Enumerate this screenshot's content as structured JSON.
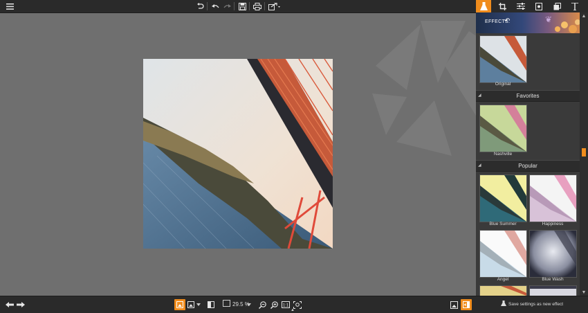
{
  "toolbar": {
    "menu_icon": "hamburger-icon",
    "rotate_label": "↶",
    "undo_label": "↶",
    "redo_label": "↷",
    "save_icon": "save-icon",
    "print_icon": "print-icon",
    "export_icon": "export-icon"
  },
  "bottombar": {
    "zoom": "29.5 %"
  },
  "panel": {
    "effects_label": "EFFECTS:",
    "top_thumb_label": "Original",
    "sections": [
      {
        "name": "Favorites"
      },
      {
        "name": "Popular"
      }
    ],
    "favorites": [
      {
        "label": "Nashville"
      }
    ],
    "popular": [
      {
        "label": "Blue Summer"
      },
      {
        "label": "Happiness"
      },
      {
        "label": "Angel"
      },
      {
        "label": "Blue Wash"
      }
    ],
    "save_effect_label": "Save settings as new effect"
  },
  "colors": {
    "accent": "#f08c1c",
    "canvas": "#6f6f6f",
    "bar": "#2a2a2a"
  }
}
